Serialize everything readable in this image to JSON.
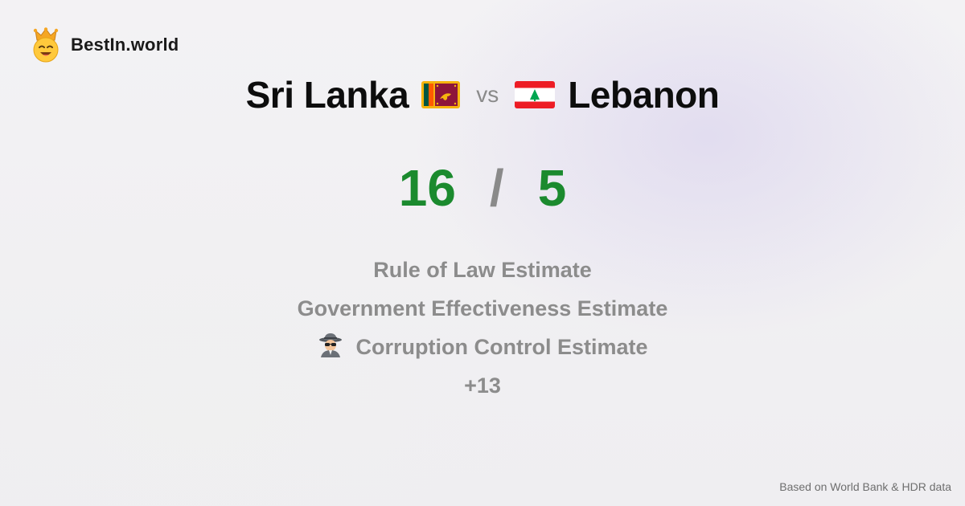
{
  "brand": {
    "name": "BestIn.world",
    "icon": "crown-smiley-icon"
  },
  "comparison": {
    "left_country": "Sri Lanka",
    "left_flag": "sri-lanka-flag-icon",
    "vs_label": "vs",
    "right_country": "Lebanon",
    "right_flag": "lebanon-flag-icon"
  },
  "scores": {
    "left": "16",
    "separator": "/",
    "right": "5",
    "color": "#1b8a2e"
  },
  "metrics": [
    {
      "label": "Rule of Law Estimate"
    },
    {
      "label": "Government Effectiveness Estimate"
    },
    {
      "label": "Corruption Control Estimate",
      "icon": "detective-icon"
    }
  ],
  "more_label": "+13",
  "footer": {
    "source": "Based on World Bank & HDR data"
  }
}
